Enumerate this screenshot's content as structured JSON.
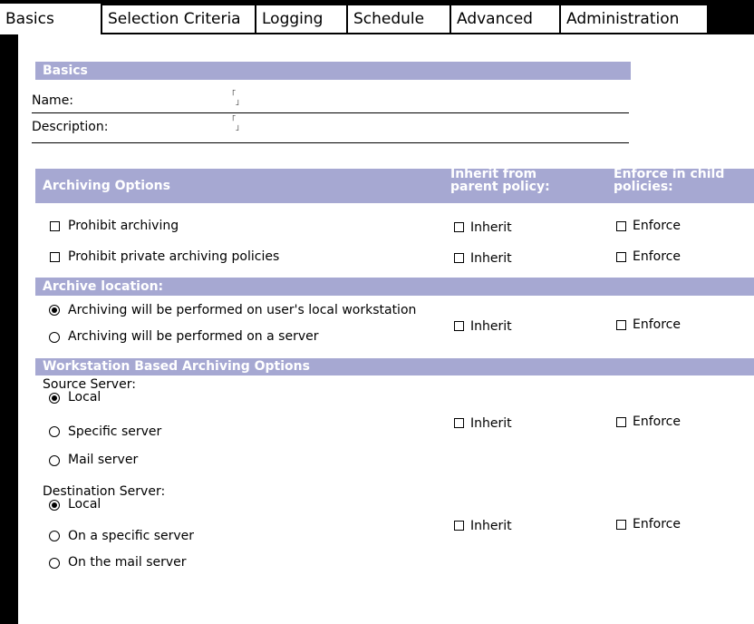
{
  "tabs": [
    "Basics",
    "Selection Criteria",
    "Logging",
    "Schedule",
    "Advanced",
    "Administration"
  ],
  "basics": {
    "header": "Basics",
    "name_label": "Name:",
    "description_label": "Description:",
    "field_marker_open": "「",
    "field_marker_close": "」"
  },
  "archiving": {
    "header": "Archiving Options",
    "inherit_header_line1": "Inherit from",
    "inherit_header_line2": "parent policy:",
    "enforce_header_line1": "Enforce in child",
    "enforce_header_line2": "policies:",
    "prohibit_archiving": "Prohibit archiving",
    "prohibit_private": "Prohibit private archiving policies"
  },
  "location": {
    "header": "Archive location:",
    "local_workstation": "Archiving will be performed on user's local workstation",
    "on_server": "Archiving will be performed on a server",
    "selected": "local_workstation"
  },
  "workstation": {
    "header": "Workstation Based Archiving Options",
    "source_label": "Source Server:",
    "source_options": [
      "Local",
      "Specific server",
      "Mail server"
    ],
    "source_selected": 0,
    "destination_label": "Destination Server:",
    "destination_options": [
      "Local",
      "On a specific server",
      "On the mail server"
    ],
    "destination_selected": 0
  },
  "common": {
    "inherit": "Inherit",
    "enforce": "Enforce"
  },
  "colors": {
    "header_bg": "#a6a8d2",
    "header_text": "#ffffff",
    "background": "#000000"
  }
}
